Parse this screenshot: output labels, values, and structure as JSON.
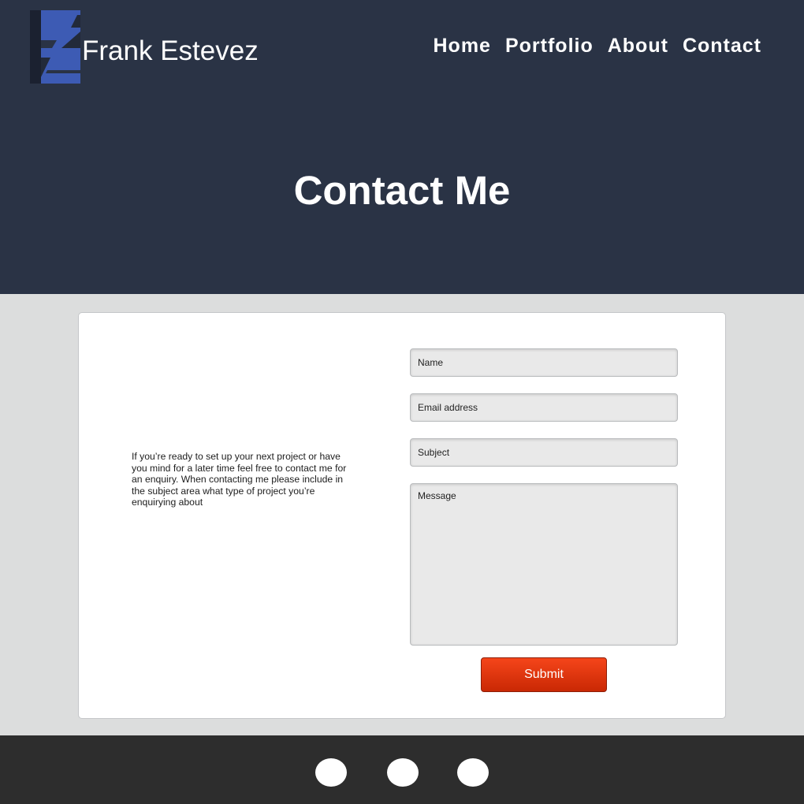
{
  "header": {
    "logo_icon": "fe-monogram-logo",
    "brand_name": "Frank Estevez",
    "nav": [
      {
        "label": "Home"
      },
      {
        "label": "Portfolio"
      },
      {
        "label": "About"
      },
      {
        "label": "Contact"
      }
    ],
    "colors": {
      "background": "#2a3345",
      "logo_blue": "#3d5bb4"
    }
  },
  "hero": {
    "title": "Contact Me"
  },
  "contact": {
    "intro": "If you’re ready to set up your next project or have you mind for a later time feel free to contact me for an enquiry. When contacting me please include in the subject area what type of project you’re enquirying about",
    "form": {
      "name_placeholder": "Name",
      "email_placeholder": "Email address",
      "subject_placeholder": "Subject",
      "message_placeholder": "Message",
      "submit_label": "Submit"
    },
    "colors": {
      "submit": "#e5360f",
      "field_bg": "#e9e9e9",
      "page_bg": "#dcdddd"
    }
  },
  "footer": {
    "social_icons": [
      "social-icon-1",
      "social-icon-2",
      "social-icon-3"
    ],
    "colors": {
      "background": "#2d2d2d"
    }
  }
}
